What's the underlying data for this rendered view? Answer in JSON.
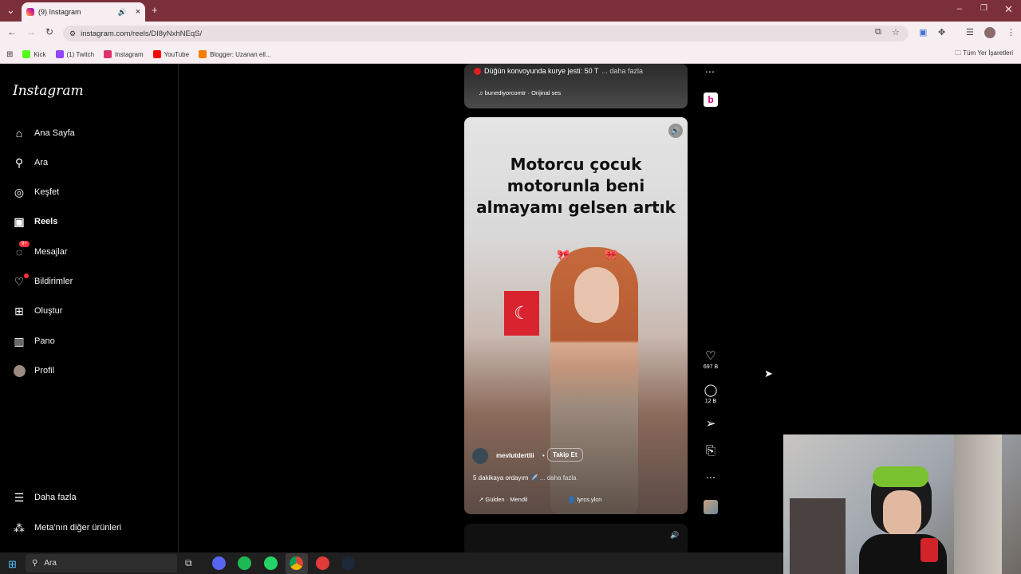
{
  "browser": {
    "tab_title": "(9) Instagram",
    "url": "instagram.com/reels/DI8yNxhNEqS/",
    "bookmarks": [
      {
        "label": "Kick",
        "color": "#53fc18"
      },
      {
        "label": "(1) Twitch",
        "color": "#9146ff"
      },
      {
        "label": "Instagram",
        "color": "#e1306c"
      },
      {
        "label": "YouTube",
        "color": "#ff0000"
      },
      {
        "label": "Blogger: Uzanan ell...",
        "color": "#f57d00"
      }
    ],
    "all_bookmarks": "Tüm Yer İşaretleri"
  },
  "sidebar": {
    "logo": "Instagram",
    "items": [
      {
        "label": "Ana Sayfa",
        "icon": "home-icon"
      },
      {
        "label": "Ara",
        "icon": "search-icon"
      },
      {
        "label": "Keşfet",
        "icon": "compass-icon"
      },
      {
        "label": "Reels",
        "icon": "reels-icon"
      },
      {
        "label": "Mesajlar",
        "icon": "messenger-icon"
      },
      {
        "label": "Bildirimler",
        "icon": "heart-icon"
      },
      {
        "label": "Oluştur",
        "icon": "plus-square-icon"
      },
      {
        "label": "Pano",
        "icon": "dashboard-icon"
      },
      {
        "label": "Profil",
        "icon": "avatar"
      }
    ],
    "messages_badge": "9+",
    "more": "Daha fazla",
    "meta": "Meta'nın diğer ürünleri"
  },
  "prev_reel": {
    "caption": "Düğün konvoyunda kurye jesti: 50 T",
    "more": "... daha fazla",
    "audio": "bunediyorcomtr · Orijinal ses"
  },
  "reel": {
    "overlay_lines": [
      "Motorcu çocuk",
      "motorunla beni",
      "almayamı gelsen artık"
    ],
    "username": "mevlutdertlii",
    "follow": "Takip Et",
    "caption": "5 dakikaya ordayım ✈️",
    "more": "... daha fazla",
    "audio": "Gülden · Mendil",
    "tagged": "lyrcs.ylcn",
    "likes": "697 B",
    "comments": "12 B"
  },
  "taskbar": {
    "search": "Ara"
  },
  "colors": {
    "tabbar": "#7b2f3a",
    "accent_red": "#ff3040"
  }
}
